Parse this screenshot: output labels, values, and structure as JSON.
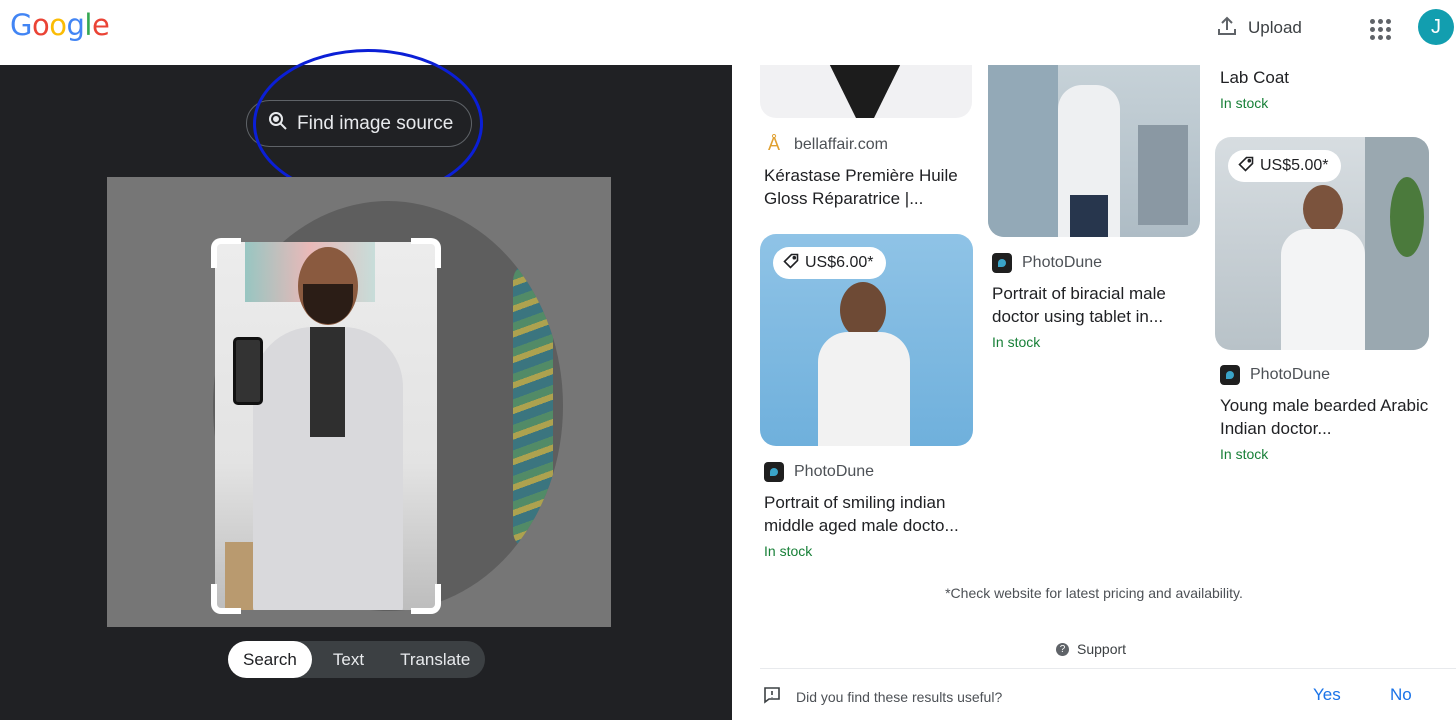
{
  "header": {
    "logo": [
      "G",
      "o",
      "o",
      "g",
      "l",
      "e"
    ],
    "upload_label": "Upload",
    "avatar_letter": "J",
    "icons": [
      "upload-icon",
      "apps-grid-icon"
    ]
  },
  "lens": {
    "find_source_label": "Find image source",
    "modes": [
      "Search",
      "Text",
      "Translate"
    ],
    "active_mode": "Search"
  },
  "results": [
    {
      "source": "bellaffair.com",
      "title": "Kérastase Première Huile Gloss Réparatrice |...",
      "price": "",
      "stock": ""
    },
    {
      "source": "PhotoDune",
      "title": "Portrait of smiling indian middle aged male docto...",
      "price": "US$6.00*",
      "stock": "In stock"
    },
    {
      "source": "PhotoDune",
      "title": "Portrait of biracial male doctor using tablet in...",
      "price": "",
      "stock": "In stock"
    },
    {
      "source": "",
      "title": "Lab Coat",
      "price": "",
      "stock": "In stock"
    },
    {
      "source": "PhotoDune",
      "title": "Young male bearded Arabic Indian doctor...",
      "price": "US$5.00*",
      "stock": "In stock"
    }
  ],
  "footer": {
    "note": "*Check website for latest pricing and availability.",
    "support": "Support",
    "feedback_question": "Did you find these results useful?",
    "yes": "Yes",
    "no": "No"
  },
  "colors": {
    "dark_panel": "#202124",
    "annotation_circle": "#0b1fd6",
    "in_stock": "#188038",
    "link": "#1a73e8"
  }
}
